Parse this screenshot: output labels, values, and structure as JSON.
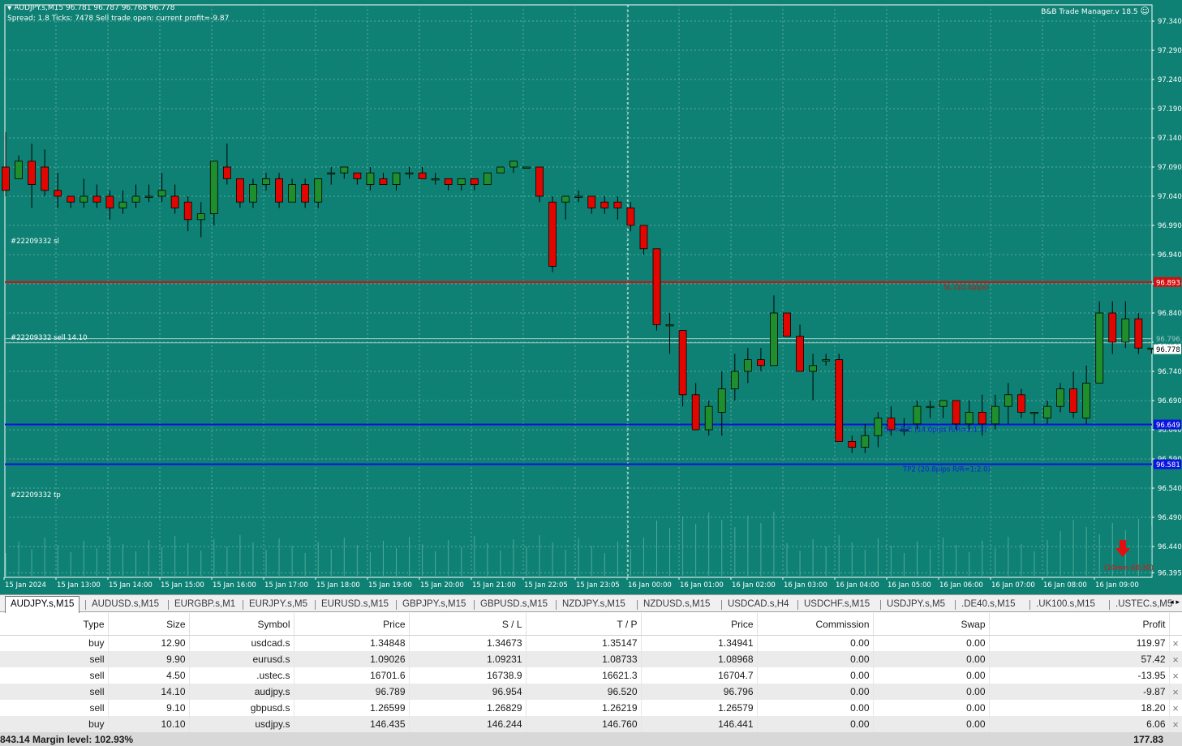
{
  "chart": {
    "symbol_line": "AUDJPY.s,M15  96.781 96.787 96.768 96.778",
    "status_line": "Spread: 1.8  Ticks: 7478  Sell trade open: current profit=-9.87",
    "tool_title": "B&B Trade Manager.v 18.5",
    "labels": {
      "sl": "#22209332 sl",
      "open": "#22209332 sell 14.10",
      "tp": "#22209332 tp"
    },
    "level_texts": {
      "sl": "SL (10.4pips)",
      "be": "SL->B/E (14.0pips R/R=1:1.3)",
      "tp2": "TP2 (20.8pips R/R=1:2.0)",
      "timer": "(10min 08:30)"
    },
    "price_tags": {
      "sl": "96.893",
      "bid": "96.778",
      "ask": "96.796",
      "be": "96.649",
      "tp2": "96.581"
    },
    "price_scale": [
      "97.340",
      "97.290",
      "97.240",
      "97.190",
      "97.140",
      "97.090",
      "97.040",
      "96.990",
      "96.940",
      "96.890",
      "96.840",
      "96.790",
      "96.740",
      "96.690",
      "96.640",
      "96.590",
      "96.540",
      "96.490",
      "96.440",
      "96.395"
    ],
    "time_labels": [
      "15 Jan 2024",
      "15 Jan 13:00",
      "15 Jan 14:00",
      "15 Jan 15:00",
      "15 Jan 16:00",
      "15 Jan 17:00",
      "15 Jan 18:00",
      "15 Jan 19:00",
      "15 Jan 20:00",
      "15 Jan 21:00",
      "15 Jan 22:05",
      "15 Jan 23:05",
      "16 Jan 00:00",
      "16 Jan 01:00",
      "16 Jan 02:00",
      "16 Jan 03:00",
      "16 Jan 04:00",
      "16 Jan 05:00",
      "16 Jan 06:00",
      "16 Jan 07:00",
      "16 Jan 08:00",
      "16 Jan 09:00"
    ],
    "colors": {
      "background": "#0e8174",
      "bull": "#1f8f2e",
      "bear": "#e10600",
      "sl_line": "#d01010",
      "target_line": "#0a14e0"
    },
    "candles": [
      [
        97.09,
        97.15,
        97.04,
        97.05
      ],
      [
        97.07,
        97.11,
        97.07,
        97.1
      ],
      [
        97.1,
        97.13,
        97.02,
        97.06
      ],
      [
        97.09,
        97.12,
        97.04,
        97.05
      ],
      [
        97.05,
        97.08,
        97.02,
        97.04
      ],
      [
        97.04,
        97.04,
        97.02,
        97.03
      ],
      [
        97.03,
        97.07,
        97.02,
        97.04
      ],
      [
        97.04,
        97.06,
        97.02,
        97.03
      ],
      [
        97.04,
        97.05,
        97.0,
        97.02
      ],
      [
        97.02,
        97.05,
        97.01,
        97.03
      ],
      [
        97.03,
        97.06,
        97.02,
        97.04
      ],
      [
        97.04,
        97.06,
        97.03,
        97.04
      ],
      [
        97.04,
        97.08,
        97.03,
        97.05
      ],
      [
        97.04,
        97.06,
        97.01,
        97.02
      ],
      [
        97.03,
        97.04,
        96.98,
        97.0
      ],
      [
        97.0,
        97.03,
        96.97,
        97.01
      ],
      [
        97.01,
        97.1,
        96.99,
        97.1
      ],
      [
        97.09,
        97.13,
        97.06,
        97.07
      ],
      [
        97.07,
        97.07,
        97.02,
        97.03
      ],
      [
        97.03,
        97.07,
        97.02,
        97.06
      ],
      [
        97.06,
        97.08,
        97.05,
        97.07
      ],
      [
        97.07,
        97.08,
        97.02,
        97.03
      ],
      [
        97.03,
        97.07,
        97.03,
        97.06
      ],
      [
        97.06,
        97.07,
        97.02,
        97.03
      ],
      [
        97.03,
        97.07,
        97.02,
        97.07
      ],
      [
        97.08,
        97.09,
        97.06,
        97.08
      ],
      [
        97.08,
        97.09,
        97.07,
        97.09
      ],
      [
        97.08,
        97.08,
        97.06,
        97.07
      ],
      [
        97.06,
        97.09,
        97.05,
        97.08
      ],
      [
        97.07,
        97.08,
        97.06,
        97.06
      ],
      [
        97.06,
        97.08,
        97.05,
        97.08
      ],
      [
        97.08,
        97.09,
        97.07,
        97.08
      ],
      [
        97.08,
        97.09,
        97.07,
        97.07
      ],
      [
        97.07,
        97.08,
        97.06,
        97.07
      ],
      [
        97.07,
        97.07,
        97.05,
        97.06
      ],
      [
        97.06,
        97.07,
        97.05,
        97.07
      ],
      [
        97.07,
        97.07,
        97.05,
        97.06
      ],
      [
        97.06,
        97.08,
        97.06,
        97.08
      ],
      [
        97.08,
        97.09,
        97.08,
        97.09
      ],
      [
        97.09,
        97.1,
        97.08,
        97.1
      ],
      [
        97.09,
        97.09,
        97.09,
        97.09
      ],
      [
        97.09,
        97.09,
        97.03,
        97.04
      ],
      [
        97.03,
        97.04,
        96.91,
        96.92
      ],
      [
        97.03,
        97.04,
        97.0,
        97.04
      ],
      [
        97.04,
        97.05,
        97.03,
        97.04
      ],
      [
        97.04,
        97.04,
        97.01,
        97.02
      ],
      [
        97.03,
        97.04,
        97.01,
        97.02
      ],
      [
        97.03,
        97.04,
        97.0,
        97.02
      ],
      [
        97.02,
        97.03,
        96.98,
        96.99
      ],
      [
        96.99,
        96.99,
        96.94,
        96.95
      ],
      [
        96.95,
        96.95,
        96.81,
        96.82
      ],
      [
        96.82,
        96.84,
        96.77,
        96.82
      ],
      [
        96.81,
        96.81,
        96.68,
        96.7
      ],
      [
        96.7,
        96.72,
        96.64,
        96.64
      ],
      [
        96.64,
        96.69,
        96.63,
        96.68
      ],
      [
        96.67,
        96.74,
        96.63,
        96.71
      ],
      [
        96.71,
        96.77,
        96.69,
        96.74
      ],
      [
        96.74,
        96.78,
        96.72,
        96.76
      ],
      [
        96.76,
        96.78,
        96.74,
        96.75
      ],
      [
        96.75,
        96.87,
        96.75,
        96.84
      ],
      [
        96.84,
        96.83,
        96.8,
        96.8
      ],
      [
        96.8,
        96.82,
        96.74,
        96.74
      ],
      [
        96.74,
        96.77,
        96.69,
        96.75
      ],
      [
        96.76,
        96.77,
        96.75,
        96.76
      ],
      [
        96.76,
        96.77,
        96.62,
        96.62
      ],
      [
        96.62,
        96.63,
        96.6,
        96.61
      ],
      [
        96.61,
        96.65,
        96.6,
        96.63
      ],
      [
        96.63,
        96.67,
        96.61,
        96.66
      ],
      [
        96.66,
        96.68,
        96.63,
        96.64
      ],
      [
        96.64,
        96.66,
        96.63,
        96.64
      ],
      [
        96.65,
        96.69,
        96.64,
        96.68
      ],
      [
        96.68,
        96.69,
        96.66,
        96.68
      ],
      [
        96.68,
        96.69,
        96.66,
        96.69
      ],
      [
        96.69,
        96.69,
        96.64,
        96.65
      ],
      [
        96.65,
        96.69,
        96.64,
        96.67
      ],
      [
        96.67,
        96.7,
        96.63,
        96.65
      ],
      [
        96.65,
        96.7,
        96.64,
        96.68
      ],
      [
        96.68,
        96.72,
        96.65,
        96.7
      ],
      [
        96.7,
        96.71,
        96.66,
        96.67
      ],
      [
        96.67,
        96.67,
        96.65,
        96.67
      ],
      [
        96.66,
        96.69,
        96.65,
        96.68
      ],
      [
        96.68,
        96.72,
        96.67,
        96.71
      ],
      [
        96.71,
        96.74,
        96.66,
        96.67
      ],
      [
        96.66,
        96.75,
        96.65,
        96.72
      ],
      [
        96.72,
        96.86,
        96.72,
        96.84
      ],
      [
        96.84,
        96.86,
        96.77,
        96.79
      ],
      [
        96.79,
        96.86,
        96.78,
        96.83
      ],
      [
        96.83,
        96.84,
        96.77,
        96.78
      ],
      [
        96.78,
        96.78,
        96.77,
        96.78
      ]
    ]
  },
  "tabs": [
    "AUDJPY.s,M15",
    "AUDUSD.s,M15",
    "EURGBP.s,M1",
    "EURJPY.s,M5",
    "EURUSD.s,M15",
    "GBPJPY.s,M15",
    "GBPUSD.s,M15",
    "NZDJPY.s,M15",
    "NZDUSD.s,M15",
    "USDCAD.s,H4",
    "USDCHF.s,M15",
    "USDJPY.s,M5",
    ".DE40.s,M15",
    ".UK100.s,M15",
    ".USTEC.s,M5"
  ],
  "tab_scroll": "◂ ▸",
  "table": {
    "headers": [
      "Type",
      "Size",
      "Symbol",
      "Price",
      "S / L",
      "T / P",
      "Price",
      "Commission",
      "Swap",
      "Profit"
    ],
    "rows": [
      [
        "buy",
        "12.90",
        "usdcad.s",
        "1.34848",
        "1.34673",
        "1.35147",
        "1.34941",
        "0.00",
        "0.00",
        "119.97"
      ],
      [
        "sell",
        "9.90",
        "eurusd.s",
        "1.09026",
        "1.09231",
        "1.08733",
        "1.08968",
        "0.00",
        "0.00",
        "57.42"
      ],
      [
        "sell",
        "4.50",
        ".ustec.s",
        "16701.6",
        "16738.9",
        "16621.3",
        "16704.7",
        "0.00",
        "0.00",
        "-13.95"
      ],
      [
        "sell",
        "14.10",
        "audjpy.s",
        "96.789",
        "96.954",
        "96.520",
        "96.796",
        "0.00",
        "0.00",
        "-9.87"
      ],
      [
        "sell",
        "9.10",
        "gbpusd.s",
        "1.26599",
        "1.26829",
        "1.26219",
        "1.26579",
        "0.00",
        "0.00",
        "18.20"
      ],
      [
        "buy",
        "10.10",
        "usdjpy.s",
        "146.435",
        "146.244",
        "146.760",
        "146.441",
        "0.00",
        "0.00",
        "6.06"
      ]
    ],
    "close_symbol": "×"
  },
  "summary": {
    "left": "843.14  Margin level: 102.93%",
    "total_profit": "177.83"
  }
}
